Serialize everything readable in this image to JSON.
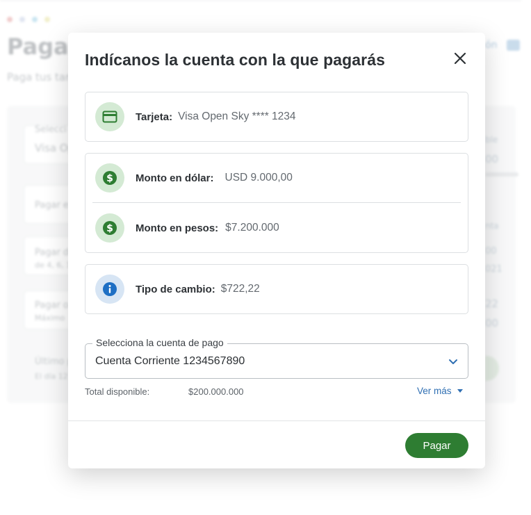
{
  "background": {
    "page_title": "Pagar",
    "page_subtitle": "Paga tus tarj",
    "side_link": "ón",
    "left_texts": [
      "Selecci",
      "Visa Op",
      "Pagar e",
      "Pagar d",
      "de 4, 6, 1",
      "Pagar o",
      "Máximo",
      "Último p",
      "El día 12"
    ],
    "right_texts": [
      "ble",
      "00",
      "nta",
      "00",
      "021",
      "22",
      "00"
    ],
    "window_dot_colors": [
      "#e6a3a3",
      "#c7d0e6",
      "#9fd0e6",
      "#e6e29f"
    ]
  },
  "modal": {
    "title": "Indícanos la cuenta con la que pagarás",
    "card": {
      "label": "Tarjeta:",
      "value": "Visa Open Sky **** 1234",
      "icon": "credit-card-icon"
    },
    "amounts": [
      {
        "label": "Monto en dólar:",
        "value": "USD 9.000,00",
        "icon": "dollar-icon"
      },
      {
        "label": "Monto en pesos:",
        "value": "$7.200.000",
        "icon": "dollar-icon"
      }
    ],
    "exchange": {
      "label": "Tipo de cambio:",
      "value": "$722,22",
      "icon": "info-icon"
    },
    "account_select": {
      "legend": "Selecciona la cuenta de pago",
      "value": "Cuenta Corriente 1234567890"
    },
    "available": {
      "label": "Total disponible:",
      "value": "$200.000.000"
    },
    "ver_mas": "Ver más",
    "pay_button": "Pagar"
  },
  "colors": {
    "primary_green": "#2e7d32",
    "link_blue": "#2f6fb3",
    "info_blue": "#1e6fc4"
  }
}
